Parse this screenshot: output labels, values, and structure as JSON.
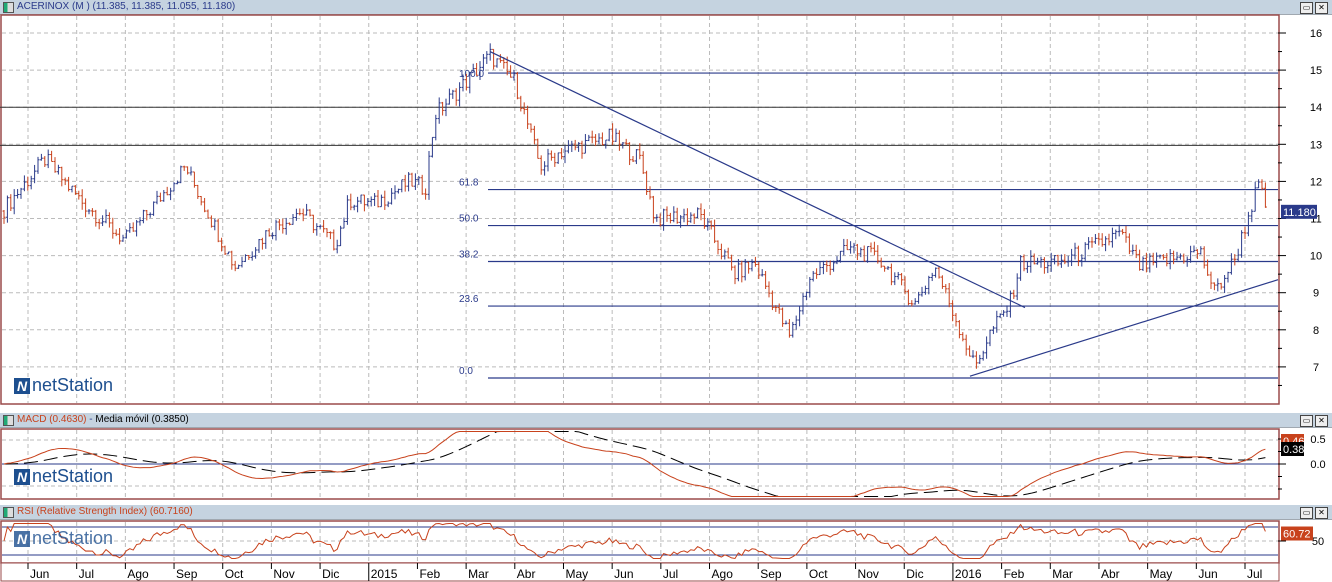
{
  "main": {
    "title": "ACERINOX (M ) (11.385, 11.385, 11.055, 11.180)",
    "last_price": "11.180",
    "y_ticks": [
      "16",
      "15",
      "14",
      "13",
      "12",
      "11",
      "10",
      "9",
      "8",
      "7"
    ],
    "fib_labels": [
      "100.0",
      "61.8",
      "50.0",
      "38.2",
      "23.6",
      "0.0"
    ]
  },
  "macd": {
    "label": "MACD (0.4630)",
    "sep": " - ",
    "ma_label": "Media móvil (0.3850)",
    "macd_value": "0.46",
    "ma_value": "0.38",
    "y_ticks": [
      "0.5",
      "0.0"
    ]
  },
  "rsi": {
    "label": "RSI (Relative Strength Index) (60.7160)",
    "value": "60.72",
    "y_ticks": [
      "50"
    ]
  },
  "logo": "netStation",
  "window_buttons": {
    "restore": "▭",
    "close": "✕"
  },
  "x_labels": [
    "Jun",
    "Jul",
    "Ago",
    "Sep",
    "Oct",
    "Nov",
    "Dic",
    "2015",
    "Feb",
    "Mar",
    "Abr",
    "May",
    "Jun",
    "Jul",
    "Ago",
    "Sep",
    "Oct",
    "Nov",
    "Dic",
    "2016",
    "Feb",
    "Mar",
    "Abr",
    "May",
    "Jun",
    "Jul"
  ],
  "colors": {
    "up": "#2a3a8a",
    "down": "#c8421c",
    "macd": "#c8421c",
    "signal": "#000000",
    "line": "#2a3a8a"
  },
  "chart_data": {
    "type": "ohlc",
    "price_range": [
      6.5,
      16.5
    ],
    "price_path_t_months_from_jun2014": [
      [
        -0.53,
        11.2
      ],
      [
        0.35,
        12.6
      ],
      [
        1.07,
        11.5
      ],
      [
        1.99,
        10.4
      ],
      [
        3.23,
        12.4
      ],
      [
        4.25,
        9.7
      ],
      [
        4.97,
        10.7
      ],
      [
        5.59,
        11.2
      ],
      [
        6.31,
        10.3
      ],
      [
        6.61,
        11.5
      ],
      [
        7.13,
        11.4
      ],
      [
        7.85,
        12.0
      ],
      [
        8.16,
        11.8
      ],
      [
        8.36,
        13.8
      ],
      [
        9.08,
        14.8
      ],
      [
        9.49,
        15.4
      ],
      [
        10.0,
        14.7
      ],
      [
        10.52,
        12.4
      ],
      [
        10.93,
        12.8
      ],
      [
        11.96,
        13.2
      ],
      [
        12.57,
        12.6
      ],
      [
        12.88,
        11.0
      ],
      [
        13.8,
        11.1
      ],
      [
        14.52,
        9.5
      ],
      [
        14.93,
        9.8
      ],
      [
        15.65,
        7.8
      ],
      [
        16.06,
        9.4
      ],
      [
        16.89,
        10.2
      ],
      [
        17.5,
        9.9
      ],
      [
        18.22,
        8.7
      ],
      [
        18.63,
        9.7
      ],
      [
        19.45,
        7.0
      ],
      [
        19.76,
        7.9
      ],
      [
        20.17,
        8.7
      ],
      [
        20.38,
        9.8
      ],
      [
        21.2,
        9.8
      ],
      [
        22.43,
        10.6
      ],
      [
        22.84,
        9.7
      ],
      [
        24.08,
        10.1
      ],
      [
        24.38,
        9.0
      ],
      [
        24.79,
        9.9
      ],
      [
        25.27,
        11.9
      ],
      [
        25.47,
        11.18
      ]
    ],
    "horizontal_levels": [
      14.0,
      12.97
    ],
    "fibonacci": {
      "high": 14.92,
      "low": 6.7,
      "levels": [
        100.0,
        61.8,
        50.0,
        38.2,
        23.6,
        0.0
      ],
      "start_t": 9.45
    },
    "trendlines": [
      {
        "name": "downtrend",
        "from": [
          9.49,
          15.5
        ],
        "to": [
          20.48,
          8.6
        ]
      },
      {
        "name": "uptrend",
        "from": [
          19.35,
          6.75
        ],
        "to": [
          25.68,
          9.35
        ]
      }
    ],
    "macd": {
      "value": 0.463,
      "signal": 0.385,
      "range": [
        -0.8,
        0.9
      ]
    },
    "rsi": {
      "value": 60.716,
      "levels": [
        70,
        30
      ],
      "range": [
        20,
        80
      ]
    }
  }
}
